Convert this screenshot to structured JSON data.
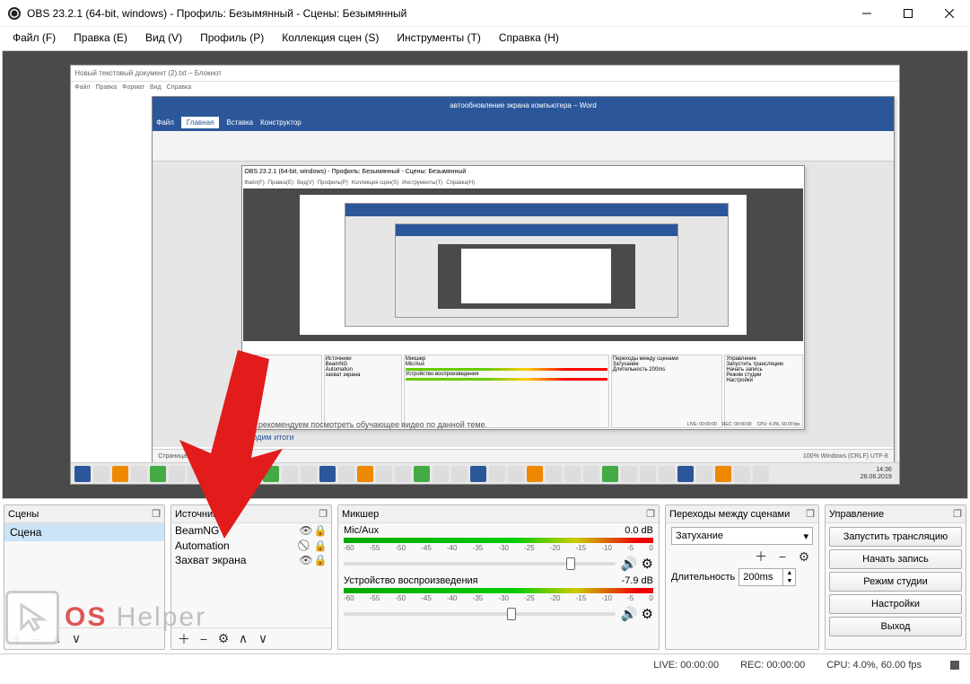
{
  "window": {
    "title": "OBS 23.2.1 (64-bit, windows) - Профиль: Безымянный - Сцены: Безымянный"
  },
  "menubar": {
    "file": "Файл (F)",
    "edit": "Правка (E)",
    "view": "Вид (V)",
    "profile": "Профиль (P)",
    "scenes": "Коллекция сцен (S)",
    "tools": "Инструменты (T)",
    "help": "Справка (H)"
  },
  "panels": {
    "scenes": {
      "title": "Сцены",
      "items": [
        "Сцена"
      ]
    },
    "sources": {
      "title": "Источники",
      "items": [
        {
          "label": "BeamNG",
          "visible": true,
          "locked": true
        },
        {
          "label": "Automation",
          "visible": false,
          "locked": true
        },
        {
          "label": "Захват экрана",
          "visible": true,
          "locked": true
        }
      ]
    },
    "mixer": {
      "title": "Микшер",
      "channels": [
        {
          "name": "Mic/Aux",
          "db": "0.0 dB",
          "thumb_pct": 82
        },
        {
          "name": "Устройство воспроизведения",
          "db": "-7.9 dB",
          "thumb_pct": 60
        }
      ],
      "ticks": [
        "-60",
        "-55",
        "-50",
        "-45",
        "-40",
        "-35",
        "-30",
        "-25",
        "-20",
        "-15",
        "-10",
        "-5",
        "0"
      ]
    },
    "transitions": {
      "title": "Переходы между сценами",
      "selected": "Затухание",
      "duration_label": "Длительность",
      "duration_value": "200ms"
    },
    "controls": {
      "title": "Управление",
      "buttons": [
        "Запустить трансляцию",
        "Начать запись",
        "Режим студии",
        "Настройки",
        "Выход"
      ]
    }
  },
  "statusbar": {
    "live": "LIVE: 00:00:00",
    "rec": "REC: 00:00:00",
    "cpu": "CPU: 4.0%, 60.00 fps"
  },
  "nested": {
    "notepad_title": "Новый текстовый документ (2).txt – Блокнот",
    "word_title": "автообновление экрана компьютера – Word",
    "obs_title": "OBS 23.2.1 (64-bit, windows) - Профиль: Безымянный - Сцены: Безымянный",
    "body_text": "Также рекомендуем посмотреть обучающее видео по данной теме.",
    "body_link": "Подводим итоги",
    "word_status_left": "Страница 1 из 1    русский",
    "word_status_right": "100%   Windows (CRLF)   UTF-8",
    "clock": "14:36\n28.06.2019"
  },
  "watermark": {
    "os": "OS",
    "helper": "Helper"
  }
}
